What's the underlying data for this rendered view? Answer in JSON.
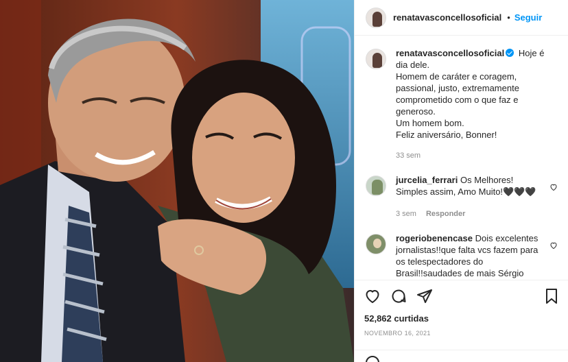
{
  "post": {
    "username": "renatavasconcellosoficial",
    "separator": "•",
    "follow_label": "Seguir",
    "caption_username": "renatavasconcellosoficial",
    "caption_lines": [
      "Hoje é",
      "dia dele.",
      "Homem de caráter e coragem,",
      "passional, justo, extremamente",
      "comprometido com o que faz e",
      "generoso.",
      "Um homem bom.",
      "Feliz aniversário, Bonner!"
    ],
    "caption_age": "33 sem",
    "likes": "52,862 curtidas",
    "date": "NOVEMBRO 16, 2021"
  },
  "comments": [
    {
      "username": "jurcelia_ferrari",
      "text_line1": "Os Melhores!",
      "text_line2": "Simples assim, Amo Muito!🖤🖤🖤",
      "age": "3 sem",
      "reply_label": "Responder"
    },
    {
      "username": "rogeriobenencase",
      "text_line1": "Dois excelentes",
      "text_line2": "jornalistas!!que falta vcs fazem para",
      "text_line3": "os telespectadores do",
      "text_line4": "Brasil!!saudades de mais Sérgio"
    }
  ],
  "icons": {
    "like": "heart-icon",
    "comment": "comment-icon",
    "share": "share-icon",
    "save": "bookmark-icon",
    "comment_like": "heart-icon"
  },
  "colors": {
    "accent": "#0095f6",
    "text": "#262626",
    "muted": "#8e8e8e",
    "border": "#efefef"
  }
}
